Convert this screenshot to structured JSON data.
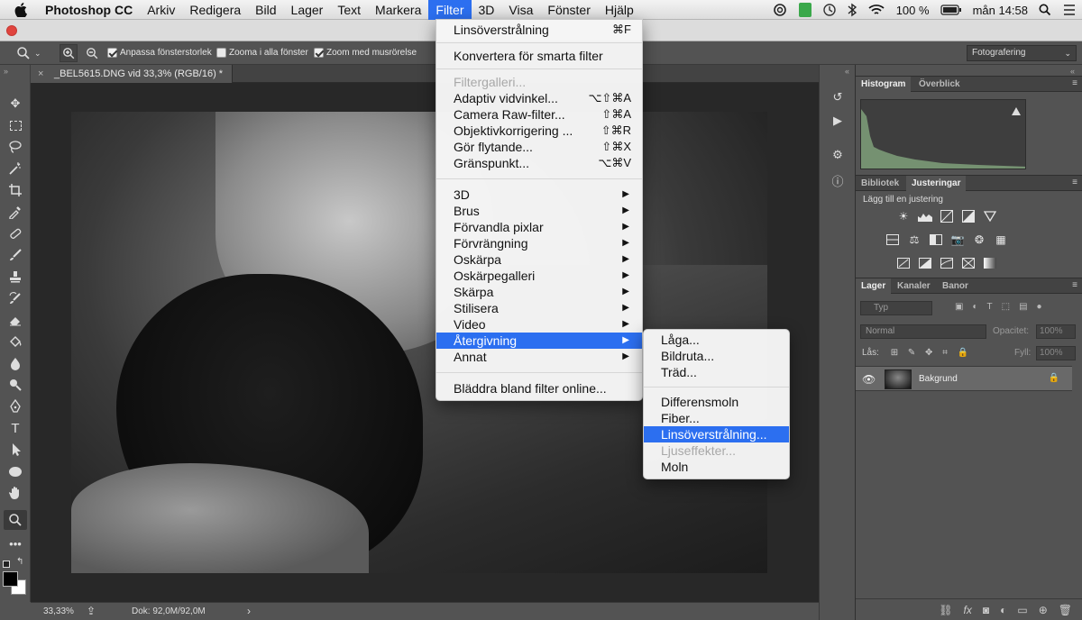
{
  "menubar": {
    "app_name": "Photoshop CC",
    "items": [
      "Arkiv",
      "Redigera",
      "Bild",
      "Lager",
      "Text",
      "Markera",
      "Filter",
      "3D",
      "Visa",
      "Fönster",
      "Hjälp"
    ],
    "status_battery": "100 %",
    "status_time": "mån 14:58"
  },
  "options": {
    "resize_windows": "Anpassa fönsterstorlek",
    "zoom_all": "Zooma i alla fönster",
    "scrubby": "Zoom med musrörelse",
    "workspace": "Fotografering"
  },
  "document": {
    "tab_title": "_BEL5615.DNG vid 33,3% (RGB/16) *",
    "close": "×"
  },
  "status": {
    "zoom": "33,33%",
    "doc_size": "Dok: 92,0M/92,0M",
    "arrow": "›"
  },
  "panels": {
    "histogram_tab": "Histogram",
    "overview_tab": "Överblick",
    "library_tab": "Bibliotek",
    "adjustments_tab": "Justeringar",
    "add_adjustment": "Lägg till en justering",
    "layers_tab": "Lager",
    "channels_tab": "Kanaler",
    "paths_tab": "Banor",
    "layer_filter": "Typ",
    "blend_mode": "Normal",
    "opacity_label": "Opacitet:",
    "opacity_value": "100%",
    "lock_label": "Lås:",
    "fill_label": "Fyll:",
    "fill_value": "100%",
    "layer_name": "Bakgrund"
  },
  "filter_menu": {
    "last_filter": "Linsöverstrålning",
    "last_filter_sc": "⌘F",
    "convert_smart": "Konvertera för smarta filter",
    "gallery": "Filtergalleri...",
    "adaptive_wide": "Adaptiv vidvinkel...",
    "adaptive_wide_sc": "⌥⇧⌘A",
    "camera_raw": "Camera Raw-filter...",
    "camera_raw_sc": "⇧⌘A",
    "lens_correction": "Objektivkorrigering ...",
    "lens_correction_sc": "⇧⌘R",
    "liquify": "Gör flytande...",
    "liquify_sc": "⇧⌘X",
    "vanishing": "Gränspunkt...",
    "vanishing_sc": "⌥⌘V",
    "sub_3d": "3D",
    "noise": "Brus",
    "pixelate": "Förvandla pixlar",
    "distort": "Förvrängning",
    "blur": "Oskärpa",
    "blur_gallery": "Oskärpegalleri",
    "sharpen": "Skärpa",
    "stylize": "Stilisera",
    "video": "Video",
    "render": "Återgivning",
    "other": "Annat",
    "browse_online": "Bläddra bland filter online..."
  },
  "render_menu": {
    "flame": "Låga...",
    "picture_frame": "Bildruta...",
    "tree": "Träd...",
    "difference_clouds": "Differensmoln",
    "fibers": "Fiber...",
    "lens_flare": "Linsöverstrålning...",
    "lighting_effects": "Ljuseffekter...",
    "clouds": "Moln"
  },
  "colors": {
    "highlight": "#2c6ff0",
    "ui_gray": "#535353"
  }
}
